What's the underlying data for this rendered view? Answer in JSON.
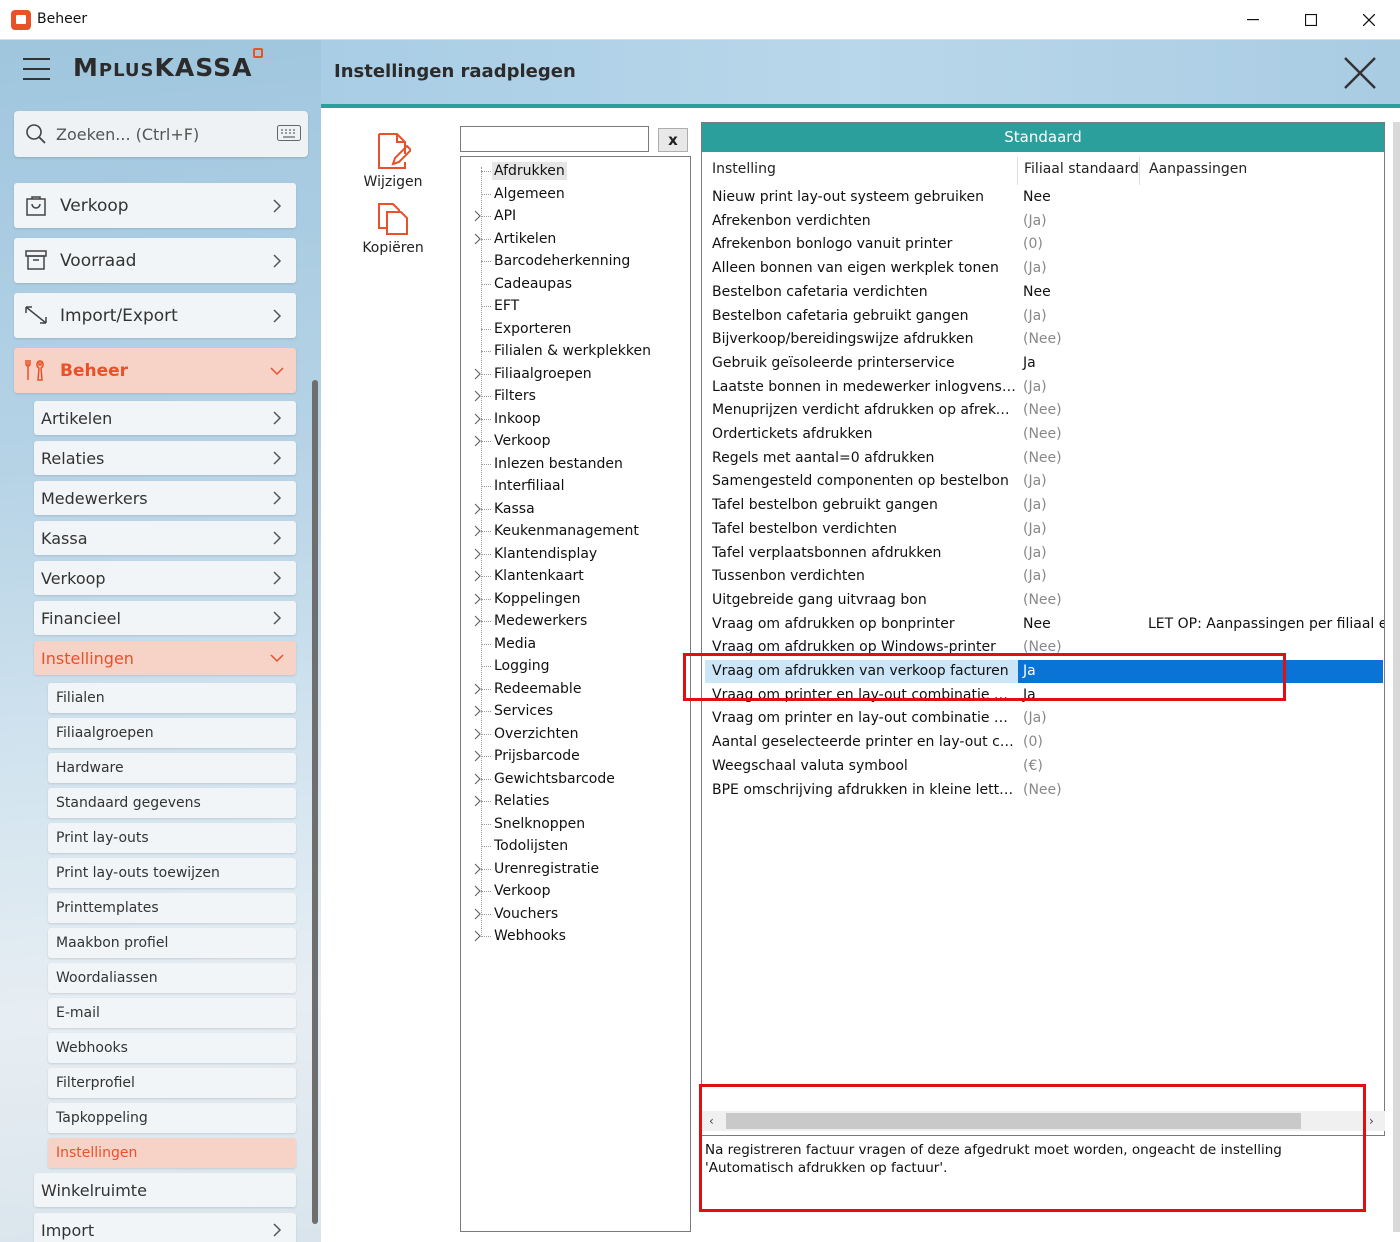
{
  "window": {
    "title": "Beheer",
    "minimize": "—",
    "maximize": "☐",
    "close": "✕"
  },
  "app": {
    "logo": "MplusKASSA",
    "page_title": "Instellingen raadplegen"
  },
  "search": {
    "placeholder": "Zoeken... (Ctrl+F)"
  },
  "nav": {
    "main": [
      {
        "label": "Verkoop",
        "icon": "bag-icon"
      },
      {
        "label": "Voorraad",
        "icon": "box-icon"
      },
      {
        "label": "Import/Export",
        "icon": "arrows-icon"
      },
      {
        "label": "Beheer",
        "icon": "tools-icon",
        "active": true
      }
    ],
    "beheer_sub": [
      "Artikelen",
      "Relaties",
      "Medewerkers",
      "Kassa",
      "Verkoop",
      "Financieel",
      "Instellingen"
    ],
    "instellingen_sub": [
      "Filialen",
      "Filiaalgroepen",
      "Hardware",
      "Standaard gegevens",
      "Print lay-outs",
      "Print lay-outs toewijzen",
      "Printtemplates",
      "Maakbon profiel",
      "Woordaliassen",
      "E-mail",
      "Webhooks",
      "Filterprofiel",
      "Tapkoppeling",
      "Instellingen"
    ],
    "after": [
      "Winkelruimte",
      "Import"
    ]
  },
  "toolbar": {
    "edit_label": "Wijzigen",
    "copy_label": "Kopiëren"
  },
  "tree": {
    "filter_value": "",
    "clear_label": "x",
    "items": [
      {
        "label": "Afdrukken",
        "expandable": false,
        "selected": true
      },
      {
        "label": "Algemeen",
        "expandable": false
      },
      {
        "label": "API",
        "expandable": true
      },
      {
        "label": "Artikelen",
        "expandable": true
      },
      {
        "label": "Barcodeherkenning",
        "expandable": false
      },
      {
        "label": "Cadeaupas",
        "expandable": false
      },
      {
        "label": "EFT",
        "expandable": false
      },
      {
        "label": "Exporteren",
        "expandable": false
      },
      {
        "label": "Filialen & werkplekken",
        "expandable": false
      },
      {
        "label": "Filiaalgroepen",
        "expandable": true
      },
      {
        "label": "Filters",
        "expandable": true
      },
      {
        "label": "Inkoop",
        "expandable": true
      },
      {
        "label": "Verkoop",
        "expandable": true
      },
      {
        "label": "Inlezen bestanden",
        "expandable": false
      },
      {
        "label": "Interfiliaal",
        "expandable": false
      },
      {
        "label": "Kassa",
        "expandable": true
      },
      {
        "label": "Keukenmanagement",
        "expandable": true
      },
      {
        "label": "Klantendisplay",
        "expandable": true
      },
      {
        "label": "Klantenkaart",
        "expandable": true
      },
      {
        "label": "Koppelingen",
        "expandable": true
      },
      {
        "label": "Medewerkers",
        "expandable": true
      },
      {
        "label": "Media",
        "expandable": false
      },
      {
        "label": "Logging",
        "expandable": false
      },
      {
        "label": "Redeemable",
        "expandable": true
      },
      {
        "label": "Services",
        "expandable": true
      },
      {
        "label": "Overzichten",
        "expandable": true
      },
      {
        "label": "Prijsbarcode",
        "expandable": true
      },
      {
        "label": "Gewichtsbarcode",
        "expandable": true
      },
      {
        "label": "Relaties",
        "expandable": true
      },
      {
        "label": "Snelknoppen",
        "expandable": false
      },
      {
        "label": "Todolijsten",
        "expandable": false
      },
      {
        "label": "Urenregistratie",
        "expandable": true
      },
      {
        "label": "Verkoop",
        "expandable": true
      },
      {
        "label": "Vouchers",
        "expandable": true
      },
      {
        "label": "Webhooks",
        "expandable": true
      }
    ]
  },
  "settings": {
    "header": "Standaard",
    "columns": [
      "Instelling",
      "Filiaal standaard",
      "Aanpassingen"
    ],
    "rows": [
      {
        "name": "Nieuw print lay-out systeem gebruiken",
        "value": "Nee",
        "muted": false,
        "custom": ""
      },
      {
        "name": "Afrekenbon verdichten",
        "value": "(Ja)",
        "muted": true,
        "custom": ""
      },
      {
        "name": "Afrekenbon bonlogo vanuit printer",
        "value": "(0)",
        "muted": true,
        "custom": ""
      },
      {
        "name": "Alleen bonnen van eigen werkplek tonen",
        "value": "(Ja)",
        "muted": true,
        "custom": ""
      },
      {
        "name": "Bestelbon cafetaria verdichten",
        "value": "Nee",
        "muted": false,
        "custom": ""
      },
      {
        "name": "Bestelbon cafetaria gebruikt gangen",
        "value": "(Ja)",
        "muted": true,
        "custom": ""
      },
      {
        "name": "Bijverkoop/bereidingswijze afdrukken",
        "value": "(Nee)",
        "muted": true,
        "custom": ""
      },
      {
        "name": "Gebruik geïsoleerde printerservice",
        "value": "Ja",
        "muted": false,
        "custom": ""
      },
      {
        "name": "Laatste bonnen in medewerker inlogvenster",
        "value": "(Ja)",
        "muted": true,
        "custom": ""
      },
      {
        "name": "Menuprijzen verdicht afdrukken op afreken...",
        "value": "(Nee)",
        "muted": true,
        "custom": ""
      },
      {
        "name": "Ordertickets afdrukken",
        "value": "(Nee)",
        "muted": true,
        "custom": ""
      },
      {
        "name": "Regels met aantal=0 afdrukken",
        "value": "(Nee)",
        "muted": true,
        "custom": ""
      },
      {
        "name": "Samengesteld componenten op bestelbon",
        "value": "(Ja)",
        "muted": true,
        "custom": ""
      },
      {
        "name": "Tafel bestelbon gebruikt gangen",
        "value": "(Ja)",
        "muted": true,
        "custom": ""
      },
      {
        "name": "Tafel bestelbon verdichten",
        "value": "(Ja)",
        "muted": true,
        "custom": ""
      },
      {
        "name": "Tafel verplaatsbonnen afdrukken",
        "value": "(Ja)",
        "muted": true,
        "custom": ""
      },
      {
        "name": "Tussenbon verdichten",
        "value": "(Ja)",
        "muted": true,
        "custom": ""
      },
      {
        "name": "Uitgebreide gang uitvraag bon",
        "value": "(Nee)",
        "muted": true,
        "custom": ""
      },
      {
        "name": "Vraag om afdrukken op bonprinter",
        "value": "Nee",
        "muted": false,
        "custom": "LET OP: Aanpassingen per filiaal en"
      },
      {
        "name": "Vraag om afdrukken op Windows-printer",
        "value": "(Nee)",
        "muted": true,
        "custom": ""
      },
      {
        "name": "Vraag om afdrukken van verkoop facturen",
        "value": "Ja",
        "muted": false,
        "custom": "",
        "selected": true
      },
      {
        "name": "Vraag om printer en lay-out combinatie vo...",
        "value": "Ja",
        "muted": false,
        "custom": ""
      },
      {
        "name": "Vraag om printer en lay-out combinatie vo...",
        "value": "(Ja)",
        "muted": true,
        "custom": ""
      },
      {
        "name": "Aantal geselecteerde printer en lay-out com...",
        "value": "(0)",
        "muted": true,
        "custom": ""
      },
      {
        "name": "Weegschaal valuta symbool",
        "value": "(€)",
        "muted": true,
        "custom": ""
      },
      {
        "name": "BPE omschrijving afdrukken in kleine letters",
        "value": "(Nee)",
        "muted": true,
        "custom": ""
      }
    ],
    "description": "Na registreren factuur vragen of deze afgedrukt moet worden, ongeacht de instelling 'Automatisch afdrukken op factuur'."
  }
}
